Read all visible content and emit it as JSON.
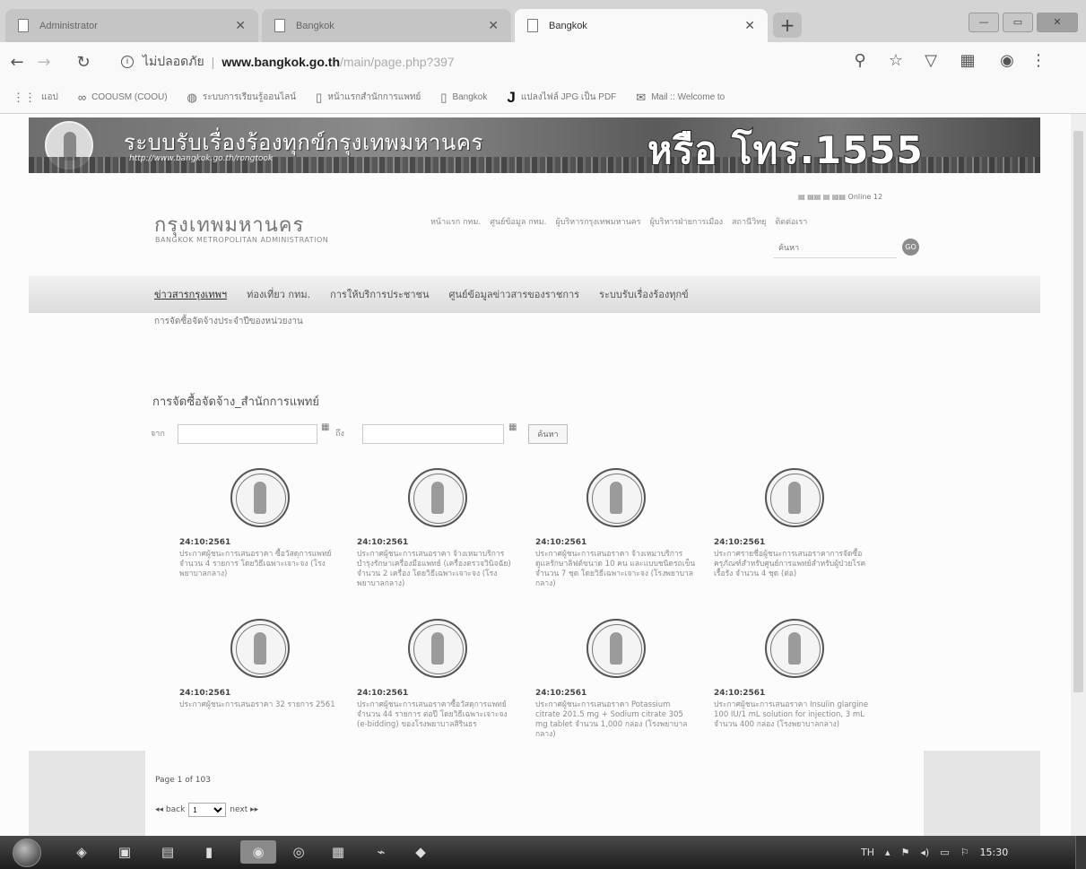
{
  "browser": {
    "tabs": [
      {
        "title": "Administrator",
        "active": false
      },
      {
        "title": "Bangkok",
        "active": false
      },
      {
        "title": "Bangkok",
        "active": true
      }
    ],
    "new_tab_symbol": "+",
    "window_controls": {
      "minimize": "—",
      "maximize": "▭",
      "close": "✕"
    },
    "address": {
      "security_label": "ไม่ปลอดภัย",
      "domain": "www.bangkok.go.th",
      "path": "/main/page.php?397"
    },
    "bookmarks": [
      {
        "icon": "apps-icon",
        "label": "แอป"
      },
      {
        "icon": "link-icon",
        "label": "COOUSM (COOU)"
      },
      {
        "icon": "globe-icon",
        "label": "ระบบการเรียนรู้ออนไลน์"
      },
      {
        "icon": "page-icon",
        "label": "หน้าแรกสำนักการแพทย์"
      },
      {
        "icon": "page-icon",
        "label": "Bangkok"
      },
      {
        "icon": "j-icon",
        "label": "แปลงไฟล์ JPG เป็น PDF"
      },
      {
        "icon": "mail-icon",
        "label": "Mail :: Welcome to"
      }
    ]
  },
  "site": {
    "banner_title": "ระบบรับเรื่องร้องทุกข์กรุงเทพมหานคร",
    "banner_url": "http://www.bangkok.go.th/rongtook",
    "banner_hotline": "หรือ โทร.1555",
    "logo_th": "กรุงเทพมหานคร",
    "logo_en": "BANGKOK METROPOLITAN ADMINISTRATION",
    "tools_text": "▤ ▤▤ ▤ ▤▤ Online 12",
    "top_links": [
      "หน้าแรก กทม.",
      "ศูนย์ข้อมูล กทม.",
      "ผู้บริหารกรุงเทพมหานคร",
      "ผู้บริหารฝ่ายการเมือง",
      "สถานีวิทยุ",
      "ติดต่อเรา"
    ],
    "search_placeholder": "ค้นหา",
    "search_button": "GO",
    "main_nav": [
      {
        "label": "ข่าวสารกรุงเทพฯ",
        "active": true
      },
      {
        "label": "ท่องเที่ยว กทม.",
        "active": false
      },
      {
        "label": "การให้บริการประชาชน",
        "active": false
      },
      {
        "label": "ศูนย์ข้อมูลข่าวสารของราชการ",
        "active": false
      },
      {
        "label": "ระบบรับเรื่องร้องทุกข์",
        "active": false
      }
    ],
    "sub_nav": "การจัดซื้อจัดจ้างประจำปีของหน่วยงาน"
  },
  "content": {
    "title": "การจัดซื้อจัดจ้าง_สำนักการแพทย์",
    "filter": {
      "from_label": "จาก",
      "to_label": "ถึง",
      "from_value": "",
      "to_value": "",
      "calendar_icon": "▦",
      "search_button": "ค้นหา"
    },
    "news": [
      {
        "date": "24:10:2561",
        "text": "ประกาศผู้ชนะการเสนอราคา ซื้อวัสดุการแพทย์ จำนวน 4 รายการ โดยวิธีเฉพาะเจาะจง (โรงพยาบาลกลาง)"
      },
      {
        "date": "24:10:2561",
        "text": "ประกาศผู้ชนะการเสนอราคา จ้างเหมาบริการบำรุงรักษาเครื่องมือแพทย์ (เครื่องตรวจวินิจฉัย) จำนวน 2 เครื่อง โดยวิธีเฉพาะเจาะจง (โรงพยาบาลกลาง)"
      },
      {
        "date": "24:10:2561",
        "text": "ประกาศผู้ชนะการเสนอราคา จ้างเหมาบริการดูแลรักษาลิฟต์ขนาด 10 คน และแบบชนิดรถเข็น จำนวน 7 ชุด โดยวิธีเฉพาะเจาะจง (โรงพยาบาลกลาง)"
      },
      {
        "date": "24:10:2561",
        "text": "ประกาศรายชื่อผู้ชนะการเสนอราคาการจัดซื้อครุภัณฑ์สำหรับศูนย์การแพทย์สำหรับผู้ป่วยโรคเรื้อรัง จำนวน 4 ชุด (ต่อ)"
      },
      {
        "date": "24:10:2561",
        "text": "ประกาศผู้ชนะการเสนอราคา 32 รายการ 2561"
      },
      {
        "date": "24:10:2561",
        "text": "ประกาศผู้ชนะการเสนอราคาซื้อวัสดุการแพทย์ จำนวน 44 รายการ ต่อปี โดยวิธีเฉพาะเจาะจง (e-bidding) ของโรงพยาบาลสิรินธร"
      },
      {
        "date": "24:10:2561",
        "text": "ประกาศผู้ชนะการเสนอราคา Potassium citrate 201.5 mg + Sodium citrate 305 mg tablet จำนวน 1,000 กล่อง (โรงพยาบาลกลาง)"
      },
      {
        "date": "24:10:2561",
        "text": "ประกาศผู้ชนะการเสนอราคา Insulin glargine 100 IU/1 mL solution for injection, 3 mL จำนวน 400 กล่อง (โรงพยาบาลกลาง)"
      }
    ],
    "pager": {
      "text": "Page 1 of 103",
      "back": "◂◂ back",
      "next": "next ▸▸",
      "selected_page": "1"
    }
  },
  "taskbar": {
    "apps": [
      "explorer-icon",
      "media-icon",
      "word-icon",
      "chrome-icon",
      "line-icon",
      "notepad-icon",
      "folder-icon",
      "app-icon"
    ],
    "tray": {
      "lang": "TH",
      "clock": "15:30"
    }
  }
}
